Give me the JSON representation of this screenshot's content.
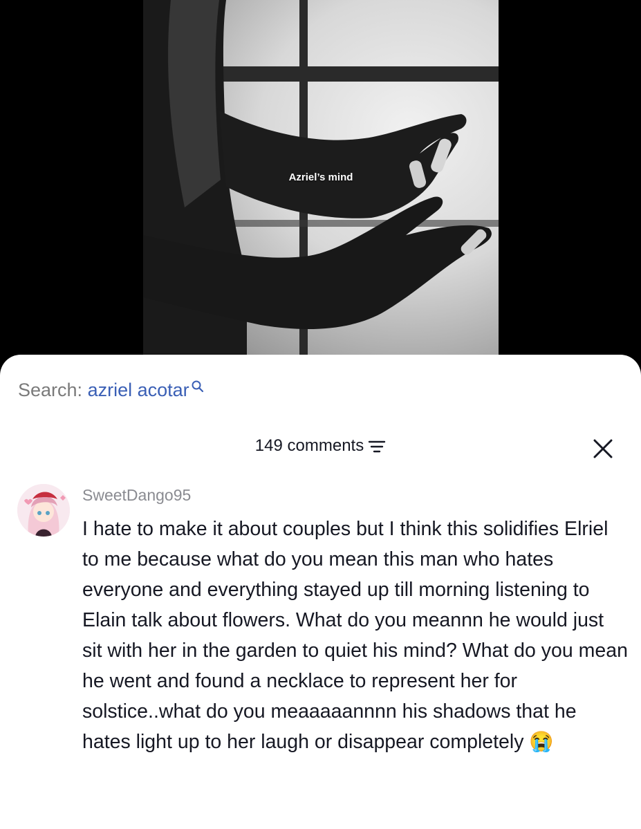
{
  "video": {
    "caption": "Azriel’s mind"
  },
  "search": {
    "label": "Search:",
    "query": "azriel acotar"
  },
  "comments_header": {
    "count_label": "149 comments"
  },
  "comment": {
    "username": "SweetDango95",
    "text": "I hate to make it about couples but I think this solidifies Elriel to me because what do you mean this man who hates everyone and everything stayed up till morning listening to Elain talk about flowers. What do you meannn he would just sit with her in the garden to quiet his mind? What do you mean he went and found a necklace to represent her for solstice..what do you meaaaaannnn his shadows that he hates light up to her laugh or disappear completely",
    "emoji": "😭"
  },
  "icons": [
    "search-icon",
    "filter-icon",
    "close-icon",
    "avatar"
  ]
}
